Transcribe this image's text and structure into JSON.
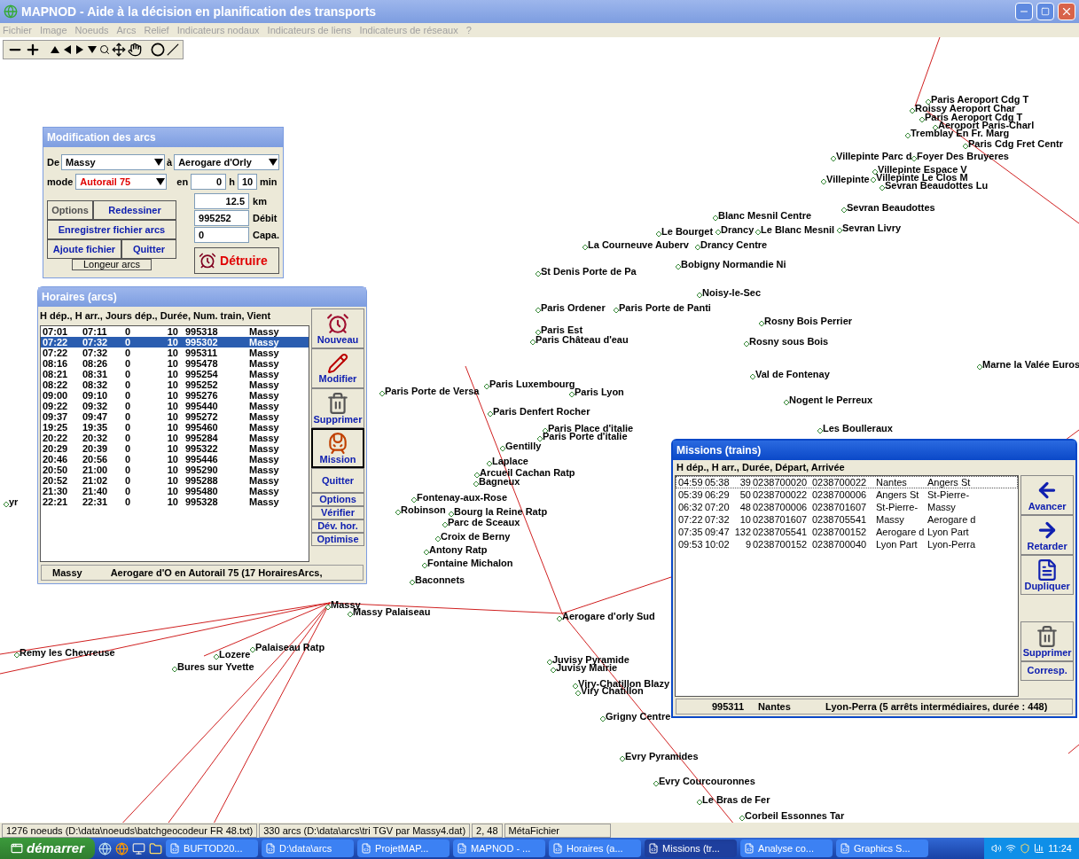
{
  "window": {
    "title": "MAPNOD - Aide à la décision en planification des transports"
  },
  "menu": [
    {
      "label": "Fichier",
      "disabled": true
    },
    {
      "label": "Image",
      "disabled": true
    },
    {
      "label": "Noeuds",
      "disabled": true
    },
    {
      "label": "Arcs",
      "disabled": true
    },
    {
      "label": "Relief",
      "disabled": true
    },
    {
      "label": "Indicateurs nodaux",
      "disabled": true
    },
    {
      "label": "Indicateurs de liens",
      "disabled": true
    },
    {
      "label": "Indicateurs de réseaux",
      "disabled": true
    },
    {
      "label": "?",
      "disabled": true
    }
  ],
  "map": {
    "nodes": [
      {
        "label": "Paris Aeroport Cdg T"
      },
      {
        "label": "Roissy Aeroport Char"
      },
      {
        "label": "Paris Aeroport Cdg T"
      },
      {
        "label": "Aeroport Paris-Charl"
      },
      {
        "label": "Tremblay En Fr. Marg"
      },
      {
        "label": "Paris Cdg Fret Centr"
      },
      {
        "label": "Villepinte Parc d"
      },
      {
        "label": "Foyer Des Bruyeres"
      },
      {
        "label": "Villepinte Espace V"
      },
      {
        "label": "Villepinte Le Clos M"
      },
      {
        "label": "Sevran Beaudottes Lu"
      },
      {
        "label": "Villepinte"
      },
      {
        "label": "Sevran Beaudottes"
      },
      {
        "label": "Blanc Mesnil Centre"
      },
      {
        "label": "Le Bourget"
      },
      {
        "label": "Drancy"
      },
      {
        "label": "Le Blanc Mesnil"
      },
      {
        "label": "Sevran Livry"
      },
      {
        "label": "La Courneuve Auberv"
      },
      {
        "label": "Drancy Centre"
      },
      {
        "label": "Bobigny Normandie Ni"
      },
      {
        "label": "St Denis Porte de Pa"
      },
      {
        "label": "Noisy-le-Sec"
      },
      {
        "label": "Paris Ordener"
      },
      {
        "label": "Paris Porte de Panti"
      },
      {
        "label": "Rosny Bois Perrier"
      },
      {
        "label": "Paris Est"
      },
      {
        "label": "Paris Château d'eau"
      },
      {
        "label": "Rosny sous Bois"
      },
      {
        "label": "Marne la Valée Euros"
      },
      {
        "label": "Val de Fontenay"
      },
      {
        "label": "Paris Luxembourg"
      },
      {
        "label": "Paris Lyon"
      },
      {
        "label": "Paris Denfert Rocher"
      },
      {
        "label": "Nogent le Perreux"
      },
      {
        "label": "Paris Porte de Versa"
      },
      {
        "label": "Paris Place d'italie"
      },
      {
        "label": "Paris Porte d'italie"
      },
      {
        "label": "Gentilly"
      },
      {
        "label": "Laplace"
      },
      {
        "label": "Arcueil Cachan Ratp"
      },
      {
        "label": "Bagneux"
      },
      {
        "label": "Fontenay-aux-Rose"
      },
      {
        "label": "Robinson"
      },
      {
        "label": "Bourg la Reine Ratp"
      },
      {
        "label": "Parc de Sceaux"
      },
      {
        "label": "Croix de Berny"
      },
      {
        "label": "Antony Ratp"
      },
      {
        "label": "Fontaine Michalon"
      },
      {
        "label": "Baconnets"
      },
      {
        "label": "Massy"
      },
      {
        "label": "Massy Palaiseau"
      },
      {
        "label": "Aerogare d'orly Sud"
      },
      {
        "label": "Remy les Chevreuse"
      },
      {
        "label": "Palaiseau Ratp"
      },
      {
        "label": "Lozere"
      },
      {
        "label": "Bures sur Yvette"
      },
      {
        "label": "Juvisy Pyramide"
      },
      {
        "label": "Juvisy Mairie"
      },
      {
        "label": "Viry-Chatillon Blazy"
      },
      {
        "label": "Viry Chatillon"
      },
      {
        "label": "Grigny Centre"
      },
      {
        "label": "Evry Pyramides"
      },
      {
        "label": "Evry Courcouronnes"
      },
      {
        "label": "Le Bras de Fer"
      },
      {
        "label": "Corbeil Essonnes Tar"
      },
      {
        "label": "Les Boulleraux"
      },
      {
        "label": "yr"
      }
    ]
  },
  "modification": {
    "title": "Modification des arcs",
    "from_label": "De",
    "from": "Massy",
    "to_label": "à",
    "to": "Aerogare d'Orly",
    "mode_label": "mode",
    "mode": "Autorail 75",
    "en_label": "en",
    "hours": "0",
    "h_label": "h",
    "minutes": "10",
    "min_label": "min",
    "distance": "12.5",
    "distance_unit": "km",
    "debit": "995252",
    "debit_label": "Débit",
    "capa": "0",
    "capa_label": "Capa.",
    "buttons": [
      "Options",
      "Redessiner",
      "Enregistrer fichier arcs",
      "Ajoute fichier",
      "Quitter"
    ],
    "tab": "Longeur arcs",
    "destroy": "Détruire"
  },
  "horaires": {
    "title": "Horaires (arcs)",
    "header": "H dép., H arr., Jours dép., Durée, Num. train, Vient",
    "rows": [
      {
        "cells": [
          "07:01",
          "07:11",
          "0",
          "10",
          "995318",
          "Massy"
        ],
        "selected": false
      },
      {
        "cells": [
          "07:22",
          "07:32",
          "0",
          "10",
          "995302",
          "Massy"
        ],
        "selected": true
      },
      {
        "cells": [
          "07:22",
          "07:32",
          "0",
          "10",
          "995311",
          "Massy"
        ],
        "selected": false
      },
      {
        "cells": [
          "08:16",
          "08:26",
          "0",
          "10",
          "995478",
          "Massy"
        ],
        "selected": false
      },
      {
        "cells": [
          "08:21",
          "08:31",
          "0",
          "10",
          "995254",
          "Massy"
        ],
        "selected": false
      },
      {
        "cells": [
          "08:22",
          "08:32",
          "0",
          "10",
          "995252",
          "Massy"
        ],
        "selected": false
      },
      {
        "cells": [
          "09:00",
          "09:10",
          "0",
          "10",
          "995276",
          "Massy"
        ],
        "selected": false
      },
      {
        "cells": [
          "09:22",
          "09:32",
          "0",
          "10",
          "995440",
          "Massy"
        ],
        "selected": false
      },
      {
        "cells": [
          "09:37",
          "09:47",
          "0",
          "10",
          "995272",
          "Massy"
        ],
        "selected": false
      },
      {
        "cells": [
          "19:25",
          "19:35",
          "0",
          "10",
          "995460",
          "Massy"
        ],
        "selected": false
      },
      {
        "cells": [
          "20:22",
          "20:32",
          "0",
          "10",
          "995284",
          "Massy"
        ],
        "selected": false
      },
      {
        "cells": [
          "20:29",
          "20:39",
          "0",
          "10",
          "995322",
          "Massy"
        ],
        "selected": false
      },
      {
        "cells": [
          "20:46",
          "20:56",
          "0",
          "10",
          "995446",
          "Massy"
        ],
        "selected": false
      },
      {
        "cells": [
          "20:50",
          "21:00",
          "0",
          "10",
          "995290",
          "Massy"
        ],
        "selected": false
      },
      {
        "cells": [
          "20:52",
          "21:02",
          "0",
          "10",
          "995288",
          "Massy"
        ],
        "selected": false
      },
      {
        "cells": [
          "21:30",
          "21:40",
          "0",
          "10",
          "995480",
          "Massy"
        ],
        "selected": false
      },
      {
        "cells": [
          "22:21",
          "22:31",
          "0",
          "10",
          "995328",
          "Massy"
        ],
        "selected": false
      }
    ],
    "buttons": [
      {
        "label": "Nouveau",
        "kind": "clock",
        "pressed": false
      },
      {
        "label": "Modifier",
        "kind": "pen",
        "pressed": false
      },
      {
        "label": "Supprimer",
        "kind": "trash",
        "pressed": false
      },
      {
        "label": "Mission",
        "kind": "train",
        "pressed": true
      },
      {
        "label": "Quitter",
        "kind": "big",
        "pressed": false
      },
      {
        "label": "Options",
        "kind": "small",
        "pressed": false
      },
      {
        "label": "Vérifier",
        "kind": "small",
        "pressed": false
      },
      {
        "label": "Dév. hor.",
        "kind": "small",
        "pressed": false
      },
      {
        "label": "Optimise",
        "kind": "small",
        "pressed": false
      }
    ],
    "status": [
      "Massy",
      "Aerogare d'O en Autorail 75  (17 HorairesArcs,"
    ]
  },
  "missions": {
    "title": "Missions (trains)",
    "header": "H dép., H arr., Durée, Départ, Arrivée",
    "rows": [
      {
        "cells": [
          "04:59",
          "05:38",
          "39",
          "0238700020",
          "0238700022",
          "Nantes",
          "Angers St"
        ],
        "focused": true
      },
      {
        "cells": [
          "05:39",
          "06:29",
          "50",
          "0238700022",
          "0238700006",
          "Angers St",
          "St-Pierre-"
        ],
        "focused": false
      },
      {
        "cells": [
          "06:32",
          "07:20",
          "48",
          "0238700006",
          "0238701607",
          "St-Pierre-",
          "Massy"
        ],
        "focused": false
      },
      {
        "cells": [
          "07:22",
          "07:32",
          "10",
          "0238701607",
          "0238705541",
          "Massy",
          "Aerogare d"
        ],
        "focused": false
      },
      {
        "cells": [
          "07:35",
          "09:47",
          "132",
          "0238705541",
          "0238700152",
          "Aerogare d",
          "Lyon Part"
        ],
        "focused": false
      },
      {
        "cells": [
          "09:53",
          "10:02",
          "9",
          "0238700152",
          "0238700040",
          "Lyon Part",
          "Lyon-Perra"
        ],
        "focused": false
      }
    ],
    "buttons": [
      {
        "label": "Avancer",
        "kind": "left"
      },
      {
        "label": "Retarder",
        "kind": "right"
      },
      {
        "label": "Dupliquer",
        "kind": "doc"
      },
      {
        "label": "Supprimer",
        "kind": "trash"
      },
      {
        "label": "Corresp.",
        "kind": "plain"
      }
    ],
    "status": [
      "995311",
      "Nantes",
      "Lyon-Perra (5 arrêts intermédiaires, durée : 448)"
    ]
  },
  "status_bar": [
    "1276 noeuds (D:\\data\\noeuds\\batchgeocodeur FR 48.txt)",
    "330 arcs (D:\\data\\arcs\\tri TGV par Massy4.dat)",
    "2, 48",
    "MétaFichier"
  ],
  "taskbar": {
    "start": "démarrer",
    "tasks": [
      {
        "label": "BUFTOD20...",
        "selected": false
      },
      {
        "label": "D:\\data\\arcs",
        "selected": false
      },
      {
        "label": "ProjetMAP...",
        "selected": false
      },
      {
        "label": "MAPNOD - ...",
        "selected": false
      },
      {
        "label": "Horaires (a...",
        "selected": false
      },
      {
        "label": "Missions (tr...",
        "selected": true
      },
      {
        "label": "Analyse co...",
        "selected": false
      },
      {
        "label": "Graphics S...",
        "selected": false
      }
    ],
    "time": "11:24"
  }
}
